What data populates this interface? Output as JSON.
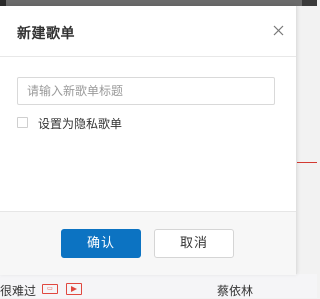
{
  "dialog": {
    "title": "新建歌单",
    "close_icon": "close-icon",
    "name_input": {
      "value": "",
      "placeholder": "请输入新歌单标题"
    },
    "private_checkbox": {
      "label": "设置为隐私歌单",
      "checked": false
    },
    "confirm_label": "确认",
    "cancel_label": "取消",
    "primary_color": "#0c73c2"
  },
  "background": {
    "song_title_partial": "很难过",
    "badges": [
      {
        "name": "sq-badge-icon",
        "color": "#e0483f"
      },
      {
        "name": "mv-play-icon",
        "color": "#e0483f"
      }
    ],
    "artist": "蔡依林",
    "accent_color": "#d33a31"
  }
}
